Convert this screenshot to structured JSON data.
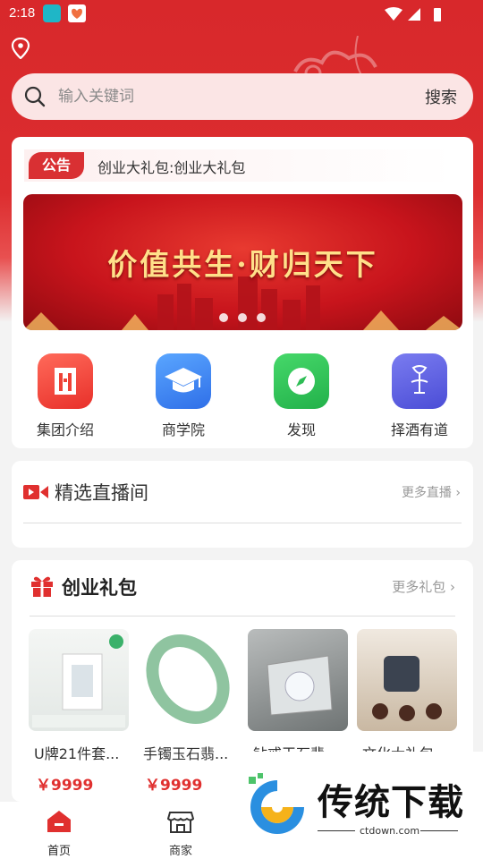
{
  "status_bar": {
    "time": "2:18"
  },
  "search": {
    "placeholder": "输入关键词",
    "button": "搜索"
  },
  "notice": {
    "badge": "公告",
    "text": "创业大礼包:创业大礼包"
  },
  "banner": {
    "title": "价值共生·财归天下"
  },
  "nav": [
    {
      "label": "集团介绍",
      "icon": "building-icon",
      "color": "#ee4236"
    },
    {
      "label": "商学院",
      "icon": "graduation-cap-icon",
      "color": "#3b82f0"
    },
    {
      "label": "发现",
      "icon": "compass-icon",
      "color": "#2dbd55"
    },
    {
      "label": "择酒有道",
      "icon": "wine-logo-icon",
      "color": "#5b5ce0"
    }
  ],
  "live": {
    "title": "精选直播间",
    "more": "更多直播"
  },
  "gift": {
    "title": "创业礼包",
    "more": "更多礼包",
    "products": [
      {
        "name": "U牌21件套...",
        "price": "￥9999"
      },
      {
        "name": "手镯玉石翡...",
        "price": "￥9999"
      },
      {
        "name": "钻戒玉石翡...",
        "price": ""
      },
      {
        "name": "文化大礼包...",
        "price": ""
      }
    ]
  },
  "tabs": [
    {
      "label": "首页",
      "icon": "home-icon",
      "active": true
    },
    {
      "label": "商家",
      "icon": "store-icon",
      "active": false
    }
  ],
  "watermark": {
    "text": "传统下载",
    "url": "ctdown.com"
  },
  "colors": {
    "primary": "#d8282b",
    "price": "#e0302f"
  }
}
